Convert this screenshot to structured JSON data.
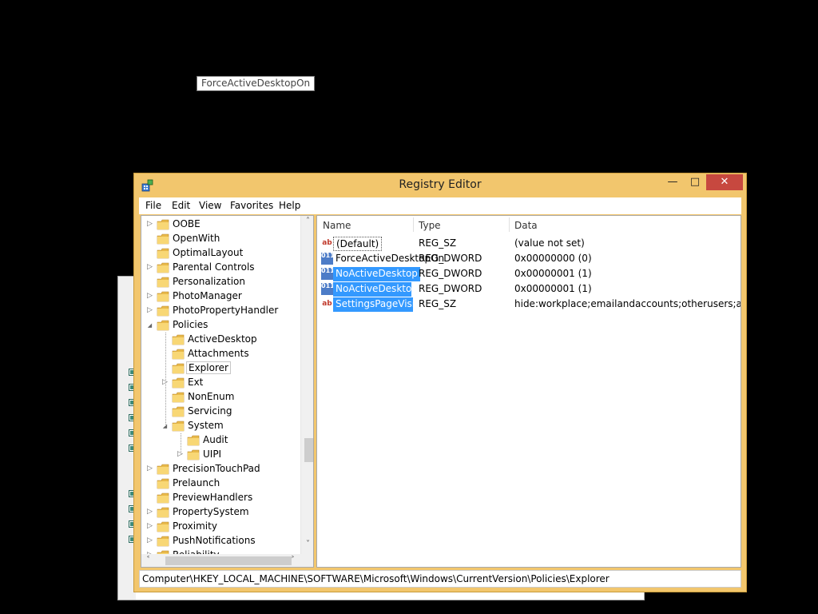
{
  "window": {
    "title": "Registry Editor",
    "accent_color": "#f2c66d",
    "close_color": "#c7483f",
    "minimize_glyph": "—",
    "maximize_glyph": "□",
    "close_glyph": "✕"
  },
  "menu": [
    "File",
    "Edit",
    "View",
    "Favorites",
    "Help"
  ],
  "tree": {
    "items": [
      {
        "label": "OOBE",
        "expandable": true
      },
      {
        "label": "OpenWith",
        "expandable": false
      },
      {
        "label": "OptimalLayout",
        "expandable": false
      },
      {
        "label": "Parental Controls",
        "expandable": true
      },
      {
        "label": "Personalization",
        "expandable": false
      },
      {
        "label": "PhotoManager",
        "expandable": true
      },
      {
        "label": "PhotoPropertyHandler",
        "expandable": true
      },
      {
        "label": "Policies",
        "expanded": true
      },
      {
        "label": "ActiveDesktop",
        "expandable": false
      },
      {
        "label": "Attachments",
        "expandable": false
      },
      {
        "label": "Explorer",
        "selected": true
      },
      {
        "label": "Ext",
        "expandable": true
      },
      {
        "label": "NonEnum",
        "expandable": false
      },
      {
        "label": "Servicing",
        "expandable": false
      },
      {
        "label": "System",
        "expanded": true
      },
      {
        "label": "Audit",
        "expandable": false
      },
      {
        "label": "UIPI",
        "expandable": true
      },
      {
        "label": "PrecisionTouchPad",
        "expandable": true
      },
      {
        "label": "Prelaunch",
        "expandable": false
      },
      {
        "label": "PreviewHandlers",
        "expandable": false
      },
      {
        "label": "PropertySystem",
        "expandable": true
      },
      {
        "label": "Proximity",
        "expandable": true
      },
      {
        "label": "PushNotifications",
        "expandable": true
      },
      {
        "label": "Reliability",
        "expandable": true
      }
    ]
  },
  "list": {
    "columns": [
      "Name",
      "Type",
      "Data"
    ],
    "rows": [
      {
        "name": "(Default)",
        "type": "REG_SZ",
        "data": "(value not set)",
        "icon": "string-value-icon",
        "glyph": "ab"
      },
      {
        "name": "ForceActiveDesktopOn",
        "type": "REG_DWORD",
        "data": "0x00000000 (0)",
        "icon": "dword-value-icon",
        "glyph": "011"
      },
      {
        "name": "NoActiveDesktop",
        "type": "REG_DWORD",
        "data": "0x00000001 (1)",
        "icon": "dword-value-icon",
        "glyph": "011"
      },
      {
        "name": "NoActiveDeskto...",
        "type": "REG_DWORD",
        "data": "0x00000001 (1)",
        "icon": "dword-value-icon",
        "glyph": "011"
      },
      {
        "name": "SettingsPageVisi...",
        "type": "REG_SZ",
        "data": "hide:workplace;emailandaccounts;otherusers;assig...",
        "icon": "string-value-icon",
        "glyph": "ab"
      }
    ],
    "tooltip": "ForceActiveDesktopOn"
  },
  "status": {
    "path": "Computer\\HKEY_LOCAL_MACHINE\\SOFTWARE\\Microsoft\\Windows\\CurrentVersion\\Policies\\Explorer"
  },
  "scroll": {
    "up_glyph": "˄",
    "down_glyph": "˅",
    "left_glyph": "˂",
    "right_glyph": "˃"
  }
}
